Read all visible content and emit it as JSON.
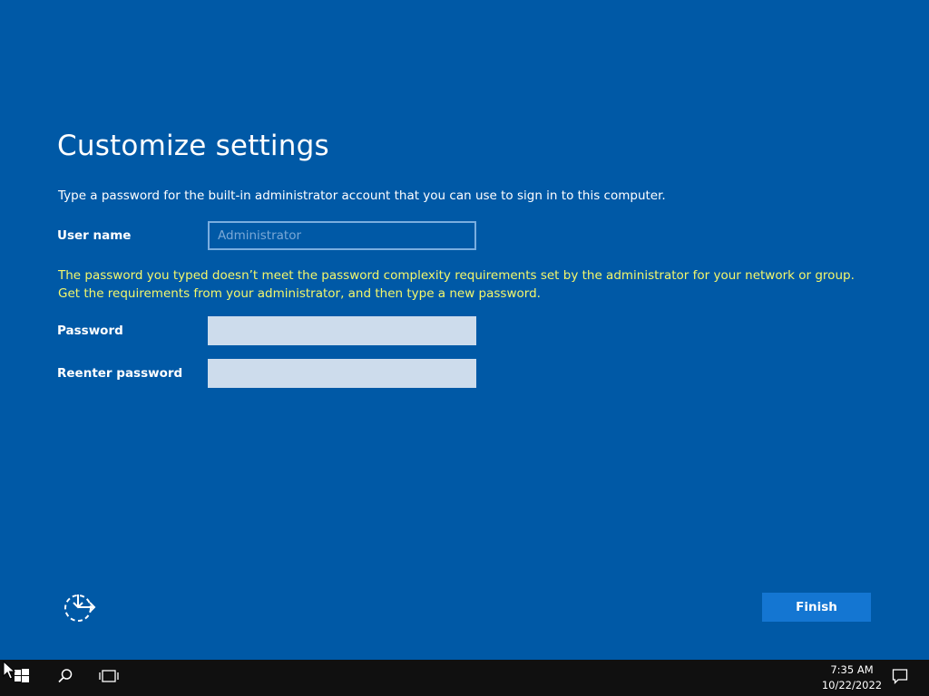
{
  "page": {
    "title": "Customize settings",
    "instruction": "Type a password for the built-in administrator account that you can use to sign in to this computer.",
    "error_message": "The password you typed doesn’t meet the password complexity requirements set by the administrator for your network or group. Get the requirements from your administrator, and then type a new password."
  },
  "form": {
    "username": {
      "label": "User name",
      "placeholder": "Administrator",
      "value": ""
    },
    "password": {
      "label": "Password",
      "value": ""
    },
    "reenter_password": {
      "label": "Reenter password",
      "value": ""
    }
  },
  "actions": {
    "finish_label": "Finish",
    "accessibility_icon": "ease-of-access-icon"
  },
  "taskbar": {
    "start_icon": "windows-logo-icon",
    "search_icon": "search-icon",
    "task_view_icon": "task-view-icon",
    "notification_icon": "action-center-icon",
    "time": "7:35 AM",
    "date": "10/22/2022"
  },
  "colors": {
    "background": "#0059a6",
    "error_text": "#f4f76b",
    "finish_button": "#1476d2",
    "input_fill": "#cddcec",
    "taskbar": "#101010"
  }
}
